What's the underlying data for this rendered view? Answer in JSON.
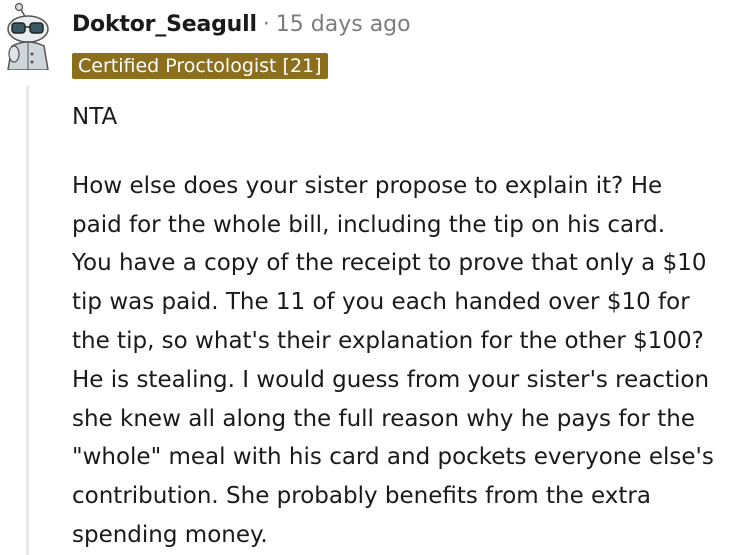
{
  "comment": {
    "author": "Doktor_Seagull",
    "separator": "·",
    "timestamp": "15 days ago",
    "flair": "Certified Proctologist [21]",
    "avatar_icon": "snoo-avatar-icon",
    "flair_color": "#8c6f1c",
    "paragraph1": "NTA",
    "paragraph2_lines": [
      "How else does your sister propose to explain it? He",
      "paid for the whole bill, including the tip on his card.",
      "You have a copy of the receipt to prove that only a $10",
      "tip was paid. The 11 of you each handed over $10 for",
      "the tip, so what's their explanation for the other $100?",
      "He is stealing. I would guess from your sister's reaction",
      "she knew all along the full reason why he pays for the",
      "\"whole\" meal with his card and pockets everyone else's",
      "contribution. She probably benefits from the extra",
      "spending money."
    ]
  }
}
